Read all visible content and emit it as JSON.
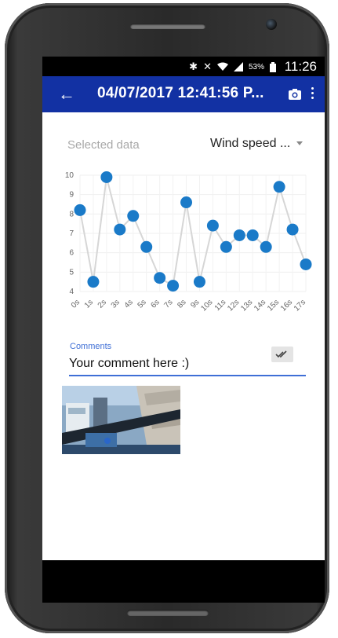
{
  "status_bar": {
    "battery_percent": "53%",
    "time": "11:26"
  },
  "app_bar": {
    "title": "04/07/2017 12:41:56 P...",
    "color": "#1231a3"
  },
  "data_selector": {
    "label": "Selected data",
    "selected_value": "Wind speed ..."
  },
  "chart_data": {
    "type": "line",
    "x": [
      "0s",
      "1s",
      "2s",
      "3s",
      "4s",
      "5s",
      "6s",
      "7s",
      "8s",
      "9s",
      "10s",
      "11s",
      "12s",
      "13s",
      "14s",
      "15s",
      "16s",
      "17s"
    ],
    "values": [
      8.2,
      4.5,
      9.9,
      7.2,
      7.9,
      6.3,
      4.7,
      4.3,
      8.6,
      4.5,
      7.4,
      6.3,
      6.9,
      6.9,
      6.3,
      9.4,
      7.2,
      5.4
    ],
    "yticks": [
      4,
      5,
      6,
      7,
      8,
      9,
      10
    ],
    "ylim": [
      4,
      10
    ],
    "grid": true,
    "point_color": "#1a7ac8",
    "line_color": "#d6d6d6"
  },
  "comments": {
    "label": "Comments",
    "value": "Your comment here :)"
  },
  "accent_color": "#3f6fd6"
}
